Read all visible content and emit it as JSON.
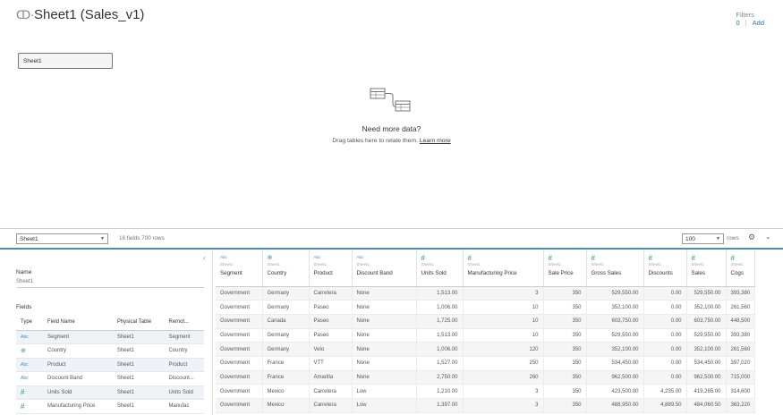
{
  "header": {
    "title": "Sheet1 (Sales_v1)",
    "filters_label": "Filters",
    "filters_count": "0",
    "filters_add": "Add"
  },
  "canvas": {
    "table_name": "Sheet1",
    "need_more": "Need more data?",
    "drag_text": "Drag tables here to relate them.",
    "learn_more": "Learn more"
  },
  "toolbar": {
    "selected_table": "Sheet1",
    "fields_rows": "16 fields 700 rows",
    "rows_value": "100",
    "rows_label": "rows"
  },
  "metadata": {
    "name_label": "Name",
    "name_value": "Sheet1",
    "fields_label": "Fields",
    "columns": [
      "Type",
      "Field Name",
      "Physical Table",
      "Remot..."
    ],
    "rows": [
      {
        "type": "Abc",
        "kind": "str",
        "field": "Segment",
        "table": "Sheet1",
        "remote": "Segment"
      },
      {
        "type": "⊕",
        "kind": "geo",
        "field": "Country",
        "table": "Sheet1",
        "remote": "Country"
      },
      {
        "type": "Abc",
        "kind": "str",
        "field": "Product",
        "table": "Sheet1",
        "remote": "Product"
      },
      {
        "type": "Abc",
        "kind": "str",
        "field": "Discount Band",
        "table": "Sheet1",
        "remote": "Discount..."
      },
      {
        "type": "#",
        "kind": "num",
        "field": "Units Sold",
        "table": "Sheet1",
        "remote": "Units Sold"
      },
      {
        "type": "#",
        "kind": "num",
        "field": "Manufacturing Price",
        "table": "Sheet1",
        "remote": "Manufac"
      }
    ]
  },
  "grid": {
    "columns": [
      {
        "type": "Abc",
        "kind": "str",
        "source": "Sheet1",
        "name": "Segment",
        "align": "l"
      },
      {
        "type": "⊕",
        "kind": "geo",
        "source": "Sheet1",
        "name": "Country",
        "align": "l"
      },
      {
        "type": "Abc",
        "kind": "str",
        "source": "Sheet1",
        "name": "Product",
        "align": "l"
      },
      {
        "type": "Abc",
        "kind": "str",
        "source": "Sheet1",
        "name": "Discount Band",
        "align": "l"
      },
      {
        "type": "#",
        "kind": "num",
        "source": "Sheet1",
        "name": "Units Sold",
        "align": "r"
      },
      {
        "type": "#",
        "kind": "num",
        "source": "Sheet1",
        "name": "Manufacturing Price",
        "align": "r"
      },
      {
        "type": "#",
        "kind": "num",
        "source": "Sheet1",
        "name": "Sale Price",
        "align": "r"
      },
      {
        "type": "#",
        "kind": "num",
        "source": "Sheet1",
        "name": "Gross Sales",
        "align": "r"
      },
      {
        "type": "#",
        "kind": "num",
        "source": "Sheet1",
        "name": "Discounts",
        "align": "r"
      },
      {
        "type": "#",
        "kind": "num",
        "source": "Sheet1",
        "name": "Sales",
        "align": "r"
      },
      {
        "type": "#",
        "kind": "num",
        "source": "Sheet1",
        "name": "Cogs",
        "align": "r"
      }
    ],
    "rows": [
      [
        "Government",
        "Germany",
        "Carretera",
        "None",
        "1,513.00",
        "3",
        "350",
        "529,550.00",
        "0.00",
        "529,550.00",
        "393,380"
      ],
      [
        "Government",
        "Germany",
        "Paseo",
        "None",
        "1,006.00",
        "10",
        "350",
        "352,100.00",
        "0.00",
        "352,100.00",
        "261,560"
      ],
      [
        "Government",
        "Canada",
        "Paseo",
        "None",
        "1,725.00",
        "10",
        "350",
        "603,750.00",
        "0.00",
        "603,750.00",
        "448,500"
      ],
      [
        "Government",
        "Germany",
        "Paseo",
        "None",
        "1,513.00",
        "10",
        "350",
        "529,550.00",
        "0.00",
        "529,550.00",
        "393,380"
      ],
      [
        "Government",
        "Germany",
        "Velo",
        "None",
        "1,006.00",
        "120",
        "350",
        "352,100.00",
        "0.00",
        "352,100.00",
        "261,560"
      ],
      [
        "Government",
        "France",
        "VTT",
        "None",
        "1,527.00",
        "250",
        "350",
        "534,450.00",
        "0.00",
        "534,450.00",
        "397,020"
      ],
      [
        "Government",
        "France",
        "Amarilla",
        "None",
        "2,750.00",
        "260",
        "350",
        "962,500.00",
        "0.00",
        "962,500.00",
        "715,000"
      ],
      [
        "Government",
        "Mexico",
        "Carretera",
        "Low",
        "1,210.00",
        "3",
        "350",
        "423,500.00",
        "4,235.00",
        "419,265.00",
        "314,600"
      ],
      [
        "Government",
        "Mexico",
        "Carretera",
        "Low",
        "1,397.00",
        "3",
        "350",
        "488,950.00",
        "4,889.50",
        "484,060.50",
        "363,220"
      ]
    ]
  }
}
